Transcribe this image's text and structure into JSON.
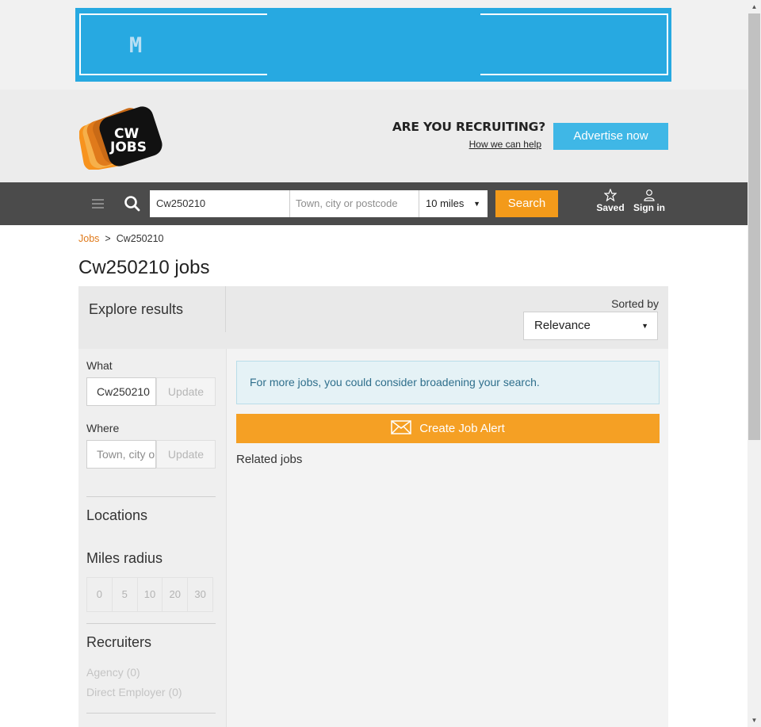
{
  "ad": {
    "logo_letter": "M",
    "color": "#27a9e1"
  },
  "header": {
    "logo_text_top": "CW",
    "logo_text_bottom": "JOBS",
    "recruiting_heading": "ARE YOU RECRUITING?",
    "how_we_can_help": "How we can help",
    "advertise_label": "Advertise now",
    "accent_color": "#3fb7e6"
  },
  "nav": {
    "what_value": "Cw250210",
    "where_placeholder": "Town, city or postcode",
    "miles_value": "10 miles",
    "search_label": "Search",
    "saved_label": "Saved",
    "signin_label": "Sign in",
    "bar_color": "#4b4b4b",
    "search_color": "#f39a1a"
  },
  "breadcrumb": {
    "jobs": "Jobs",
    "separator": ">",
    "current": "Cw250210"
  },
  "page_title": "Cw250210 jobs",
  "results": {
    "explore_title": "Explore results",
    "sorted_by_label": "Sorted by",
    "sort_value": "Relevance"
  },
  "sidebar": {
    "what_label": "What",
    "what_value": "Cw250210",
    "where_label": "Where",
    "where_placeholder": "Town, city or postcode",
    "update_label": "Update",
    "locations_heading": "Locations",
    "miles_radius_heading": "Miles radius",
    "radius_options": [
      "0",
      "5",
      "10",
      "20",
      "30"
    ],
    "recruiters_heading": "Recruiters",
    "recruiters": [
      "Agency (0)",
      "Direct Employer (0)"
    ]
  },
  "main": {
    "info_text": "For more jobs, you could consider broadening your search.",
    "create_alert_label": "Create Job Alert",
    "related_jobs_label": "Related jobs"
  }
}
